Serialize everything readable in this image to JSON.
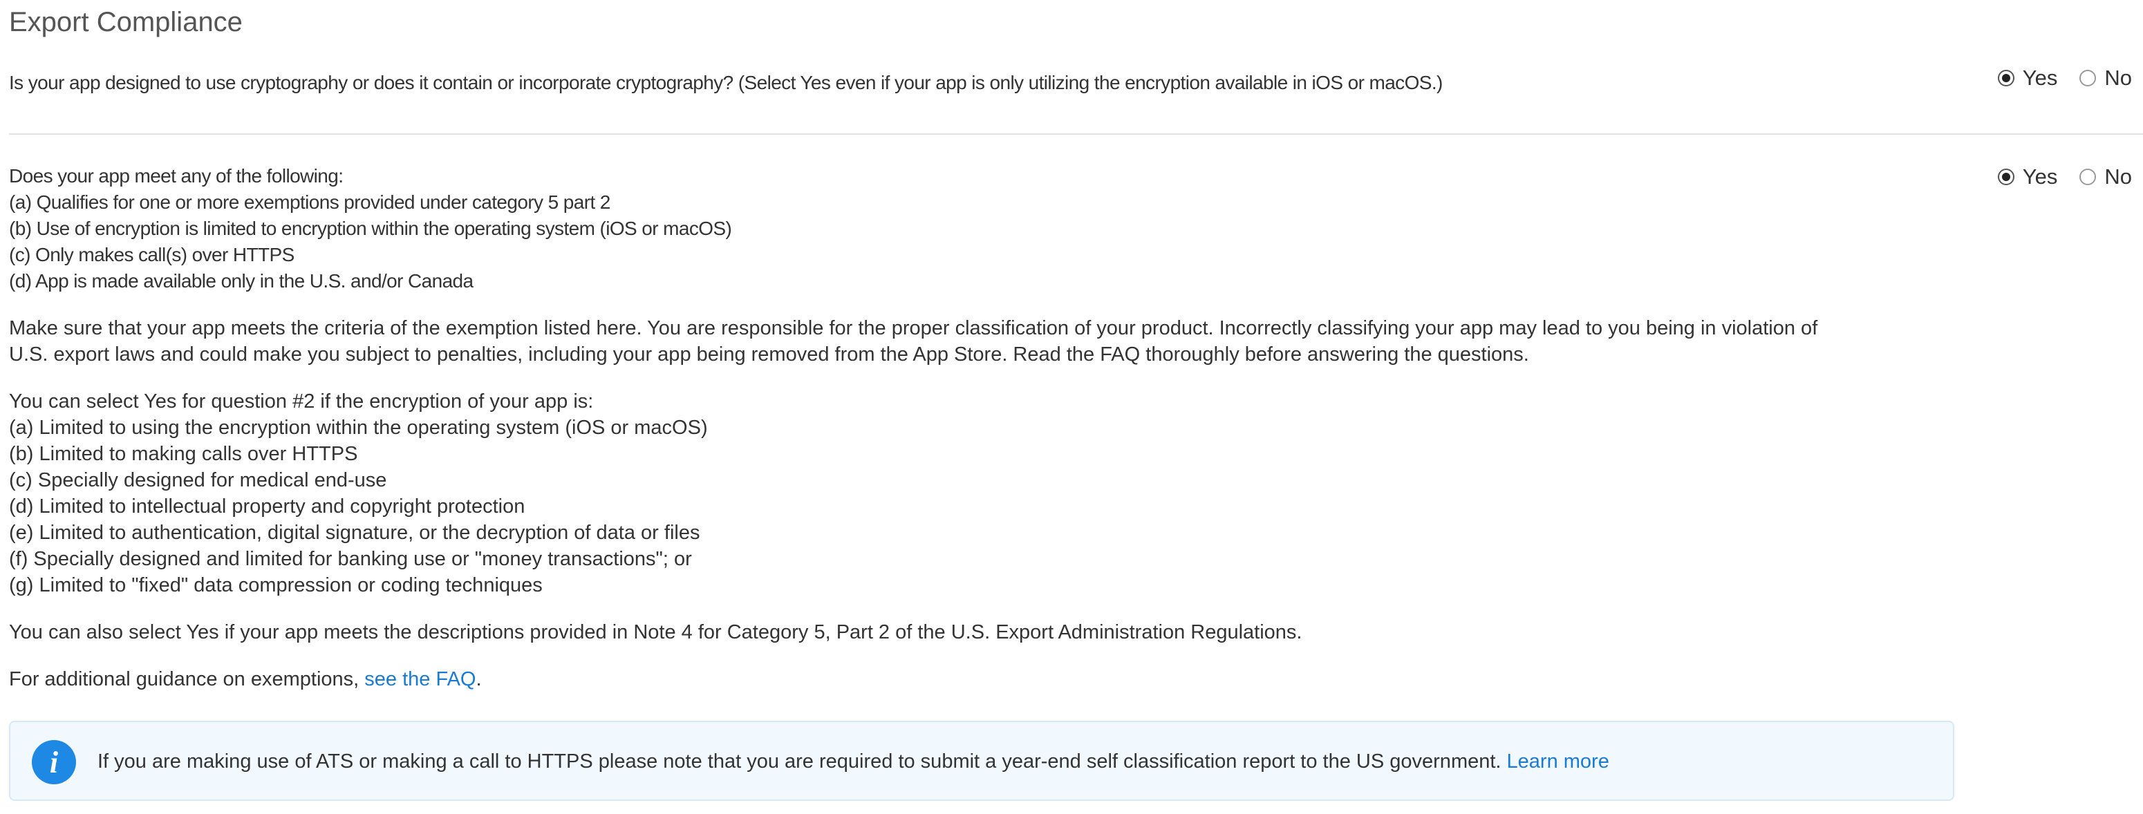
{
  "page": {
    "title": "Export Compliance"
  },
  "question1": {
    "text": "Is your app designed to use cryptography or does it contain or incorporate cryptography? (Select Yes even if your app is only utilizing the encryption available in iOS or macOS.)",
    "options": [
      "Yes",
      "No"
    ],
    "selected": "Yes"
  },
  "question2": {
    "lines": [
      "Does your app meet any of the following:",
      "(a) Qualifies for one or more exemptions provided under category 5 part 2",
      "(b) Use of encryption is limited to encryption within the operating system (iOS or macOS)",
      "(c) Only makes call(s) over HTTPS",
      "(d) App is made available only in the U.S. and/or Canada"
    ],
    "options": [
      "Yes",
      "No"
    ],
    "selected": "Yes"
  },
  "notice": {
    "lines": [
      "Make sure that your app meets the criteria of the exemption listed here. You are responsible for the proper classification of your product. Incorrectly classifying your app may lead to you being in violation of",
      "U.S. export laws and could make you subject to penalties, including your app being removed from the App Store. Read the FAQ thoroughly before answering the questions."
    ]
  },
  "criteria": {
    "intro": "You can select Yes for question #2 if the encryption of your app is:",
    "items": [
      "(a) Limited to using the encryption within the operating system (iOS or macOS)",
      "(b) Limited to making calls over HTTPS",
      "(c) Specially designed for medical end-use",
      "(d) Limited to intellectual property and copyright protection",
      "(e) Limited to authentication, digital signature, or the decryption of data or files",
      "(f) Specially designed and limited for banking use or \"money transactions\"; or",
      "(g) Limited to \"fixed\" data compression or coding techniques"
    ]
  },
  "note4": "You can also select Yes if your app meets the descriptions provided in Note 4 for Category 5, Part 2 of the U.S. Export Administration Regulations.",
  "guidance": {
    "prefix": "For additional guidance on exemptions, ",
    "link": "see the FAQ",
    "suffix": "."
  },
  "info": {
    "icon": "info-icon",
    "icon_glyph": "i",
    "text": "If you are making use of ATS or making a call to HTTPS please note that you are required to submit a year-end self classification report to the US government. ",
    "link": "Learn more"
  },
  "colors": {
    "link": "#1a7bd6",
    "info_background": "#f1f8fe",
    "info_icon": "#1e88e5",
    "text": "#333333"
  }
}
